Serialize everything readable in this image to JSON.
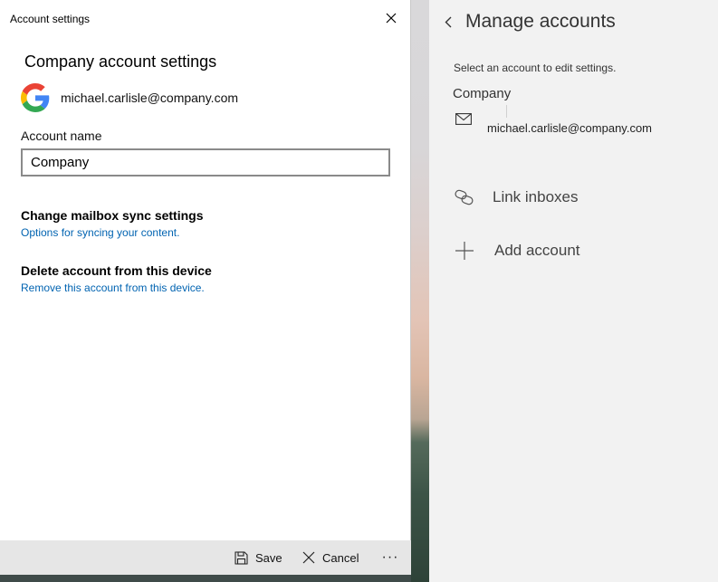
{
  "dialog": {
    "title": "Account settings",
    "heading": "Company account settings",
    "account_email": "michael.carlisle@company.com",
    "account_name_label": "Account name",
    "account_name_value": "Company",
    "sync_section": {
      "title": "Change mailbox sync settings",
      "link": "Options for syncing your content."
    },
    "delete_section": {
      "title": "Delete account from this device",
      "link": "Remove this account from this device."
    },
    "commands": {
      "save": "Save",
      "cancel": "Cancel",
      "more": "···"
    }
  },
  "manage_pane": {
    "title": "Manage accounts",
    "hint": "Select an account to edit settings.",
    "account": {
      "name": "Company",
      "email": "michael.carlisle@company.com",
      "icon": "mail-icon"
    },
    "actions": [
      {
        "label": "Link inboxes",
        "icon": "link-icon"
      },
      {
        "label": "Add account",
        "icon": "plus-icon"
      }
    ]
  },
  "colors": {
    "link_blue": "#0063b1",
    "pane_bg": "#f2f2f2",
    "command_bar_bg": "#e6e6e6"
  }
}
